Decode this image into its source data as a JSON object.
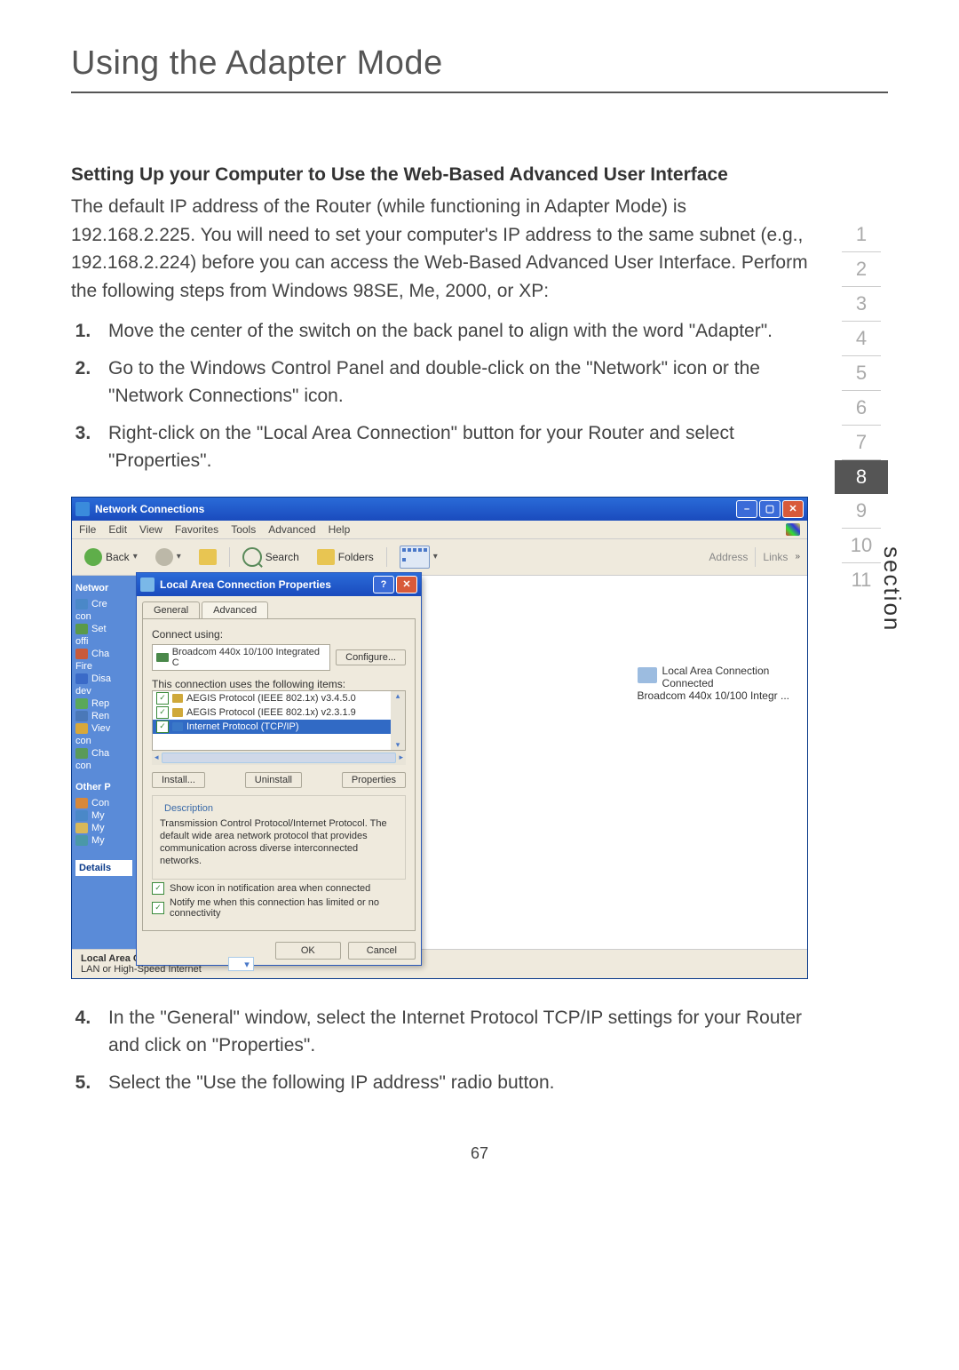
{
  "page_title": "Using the Adapter Mode",
  "section_label": "section",
  "nav_numbers": [
    "1",
    "2",
    "3",
    "4",
    "5",
    "6",
    "7",
    "8",
    "9",
    "10",
    "11"
  ],
  "nav_active": "8",
  "subheading": "Setting Up your Computer to Use the Web-Based Advanced User Interface",
  "paragraph": "The default IP address of the Router (while functioning in Adapter Mode) is 192.168.2.225. You will need to set your computer's IP address to the same subnet (e.g., 192.168.2.224) before you can access the Web-Based Advanced User Interface. Perform the following steps from Windows 98SE, Me, 2000, or XP:",
  "steps_a": [
    "Move the center of the switch on the back panel to align with the word \"Adapter\".",
    "Go to the Windows Control Panel and double-click on the \"Network\" icon or the \"Network Connections\" icon.",
    "Right-click on the \"Local Area Connection\" button for your Router and select \"Properties\"."
  ],
  "steps_b": [
    "In the \"General\" window, select the Internet Protocol TCP/IP settings for your Router and click on \"Properties\".",
    "Select the \"Use the following IP address\" radio button."
  ],
  "page_number": "67",
  "window": {
    "title": "Network Connections",
    "menus": [
      "File",
      "Edit",
      "View",
      "Favorites",
      "Tools",
      "Advanced",
      "Help"
    ],
    "back": "Back",
    "search": "Search",
    "folders": "Folders",
    "address": "Address",
    "links": "Links",
    "taskpane_header": "Networ",
    "tp_items1": [
      "Cre",
      "con",
      "Set",
      "offi",
      "Cha",
      "Fire",
      "Disa",
      "dev",
      "Rep",
      "Ren",
      "Viev",
      "con",
      "Cha",
      "con"
    ],
    "tp_other": "Other P",
    "tp_items2": [
      "Con",
      "My",
      "My",
      "My"
    ],
    "tp_details": "Details",
    "status_line1": "Local Area Connection",
    "status_line2": "LAN or High-Speed Internet",
    "conn_name": "Local Area Connection",
    "conn_state": "Connected",
    "conn_device": "Broadcom 440x 10/100 Integr ..."
  },
  "dialog": {
    "title": "Local Area Connection Properties",
    "tab_general": "General",
    "tab_advanced": "Advanced",
    "connect_using": "Connect using:",
    "nic": "Broadcom 440x 10/100 Integrated C",
    "configure": "Configure...",
    "uses_text": "This connection uses the following items:",
    "item1": "AEGIS Protocol (IEEE 802.1x) v3.4.5.0",
    "item2": "AEGIS Protocol (IEEE 802.1x) v2.3.1.9",
    "item3": "Internet Protocol (TCP/IP)",
    "install": "Install...",
    "uninstall": "Uninstall",
    "properties": "Properties",
    "description_lbl": "Description",
    "description": "Transmission Control Protocol/Internet Protocol. The default wide area network protocol that provides communication across diverse interconnected networks.",
    "chk1": "Show icon in notification area when connected",
    "chk2": "Notify me when this connection has limited or no connectivity",
    "ok": "OK",
    "cancel": "Cancel"
  }
}
